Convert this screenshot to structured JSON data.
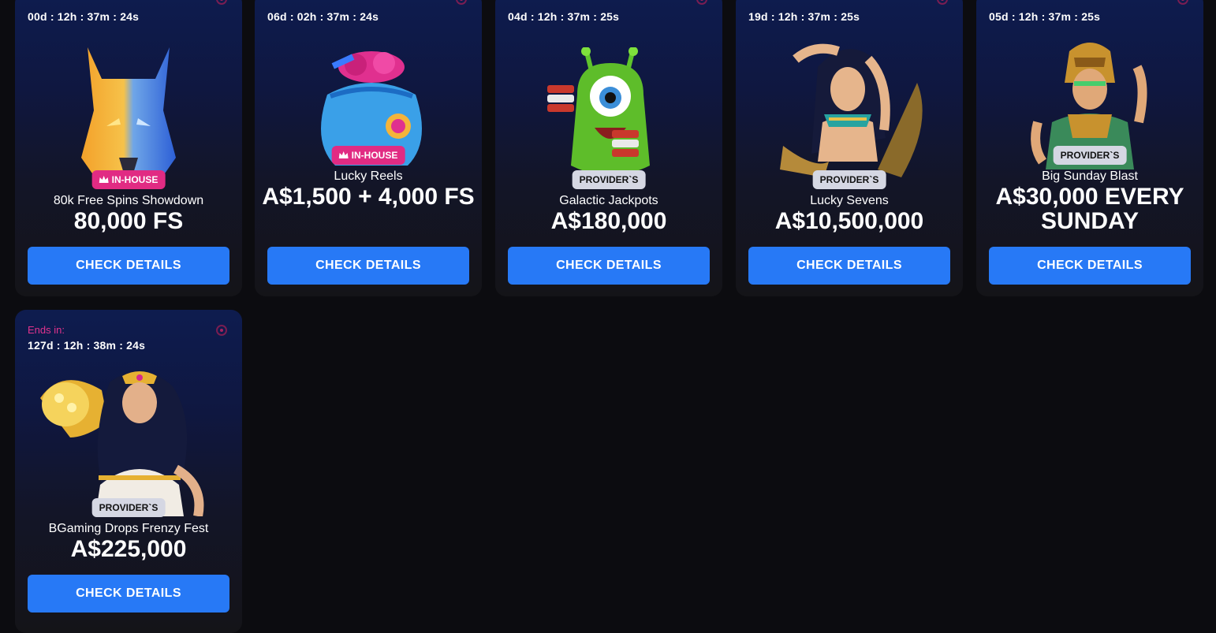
{
  "promos": [
    {
      "ends_label": "",
      "timer": "00d : 12h : 37m : 24s",
      "badge": "IN-HOUSE",
      "badge_type": "inhouse",
      "title": "80k Free Spins Showdown",
      "prize": "80,000 FS",
      "cta": "CHECK DETAILS",
      "art_icon": "wolf-icon"
    },
    {
      "ends_label": "",
      "timer": "06d : 02h : 37m : 24s",
      "badge": "IN-HOUSE",
      "badge_type": "inhouse",
      "title": "Lucky Reels",
      "prize": "A$1,500 + 4,000 FS",
      "cta": "CHECK DETAILS",
      "art_icon": "coin-bag-icon"
    },
    {
      "ends_label": "",
      "timer": "04d : 12h : 37m : 25s",
      "badge": "PROVIDER`S",
      "badge_type": "provider",
      "title": "Galactic Jackpots",
      "prize": "A$180,000",
      "cta": "CHECK DETAILS",
      "art_icon": "alien-icon"
    },
    {
      "ends_label": "",
      "timer": "19d : 12h : 37m : 25s",
      "badge": "PROVIDER`S",
      "badge_type": "provider",
      "title": "Lucky Sevens",
      "prize": "A$10,500,000",
      "cta": "CHECK DETAILS",
      "art_icon": "egyptian-queen-icon"
    },
    {
      "ends_label": "",
      "timer": "05d : 12h : 37m : 25s",
      "badge": "PROVIDER`S",
      "badge_type": "provider",
      "title": "Big Sunday Blast",
      "prize": "A$30,000 EVERY SUNDAY",
      "cta": "CHECK DETAILS",
      "art_icon": "aztec-warrior-icon"
    },
    {
      "ends_label": "Ends in:",
      "timer": "127d : 12h : 38m : 24s",
      "badge": "PROVIDER`S",
      "badge_type": "provider",
      "title": "BGaming Drops Frenzy Fest",
      "prize": "A$225,000",
      "cta": "CHECK DETAILS",
      "art_icon": "goddess-cornucopia-icon"
    }
  ],
  "colors": {
    "background": "#0c0c10",
    "button": "#2779f6",
    "inhouse_badge": "#e12b83",
    "provider_badge": "#d5d7e3",
    "ends_label": "#e1338d"
  }
}
